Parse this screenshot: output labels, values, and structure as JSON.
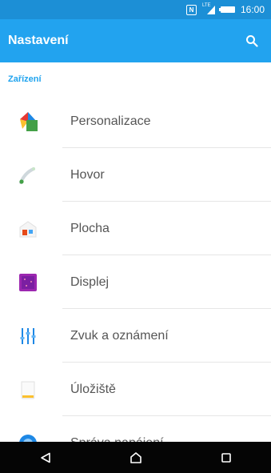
{
  "status_bar": {
    "time": "16:00",
    "nfc_glyph": "N",
    "network": "LTE",
    "icons": [
      "nfc-icon",
      "lte-signal-icon",
      "battery-icon"
    ]
  },
  "app_bar": {
    "title": "Nastavení",
    "search_icon": "search-icon",
    "color": "#22a3ef"
  },
  "section": {
    "header": "Zařízení",
    "accent_color": "#1fa3ee"
  },
  "items": [
    {
      "label": "Personalizace",
      "icon": "personalization-icon"
    },
    {
      "label": "Hovor",
      "icon": "phone-handset-icon"
    },
    {
      "label": "Plocha",
      "icon": "home-screen-icon"
    },
    {
      "label": "Displej",
      "icon": "display-icon"
    },
    {
      "label": "Zvuk a oznámení",
      "icon": "equalizer-icon"
    },
    {
      "label": "Úložiště",
      "icon": "storage-icon"
    },
    {
      "label": "Správa napájení",
      "icon": "power-management-icon"
    }
  ],
  "nav_bar": {
    "buttons": [
      "back-icon",
      "home-icon",
      "recent-apps-icon"
    ]
  }
}
